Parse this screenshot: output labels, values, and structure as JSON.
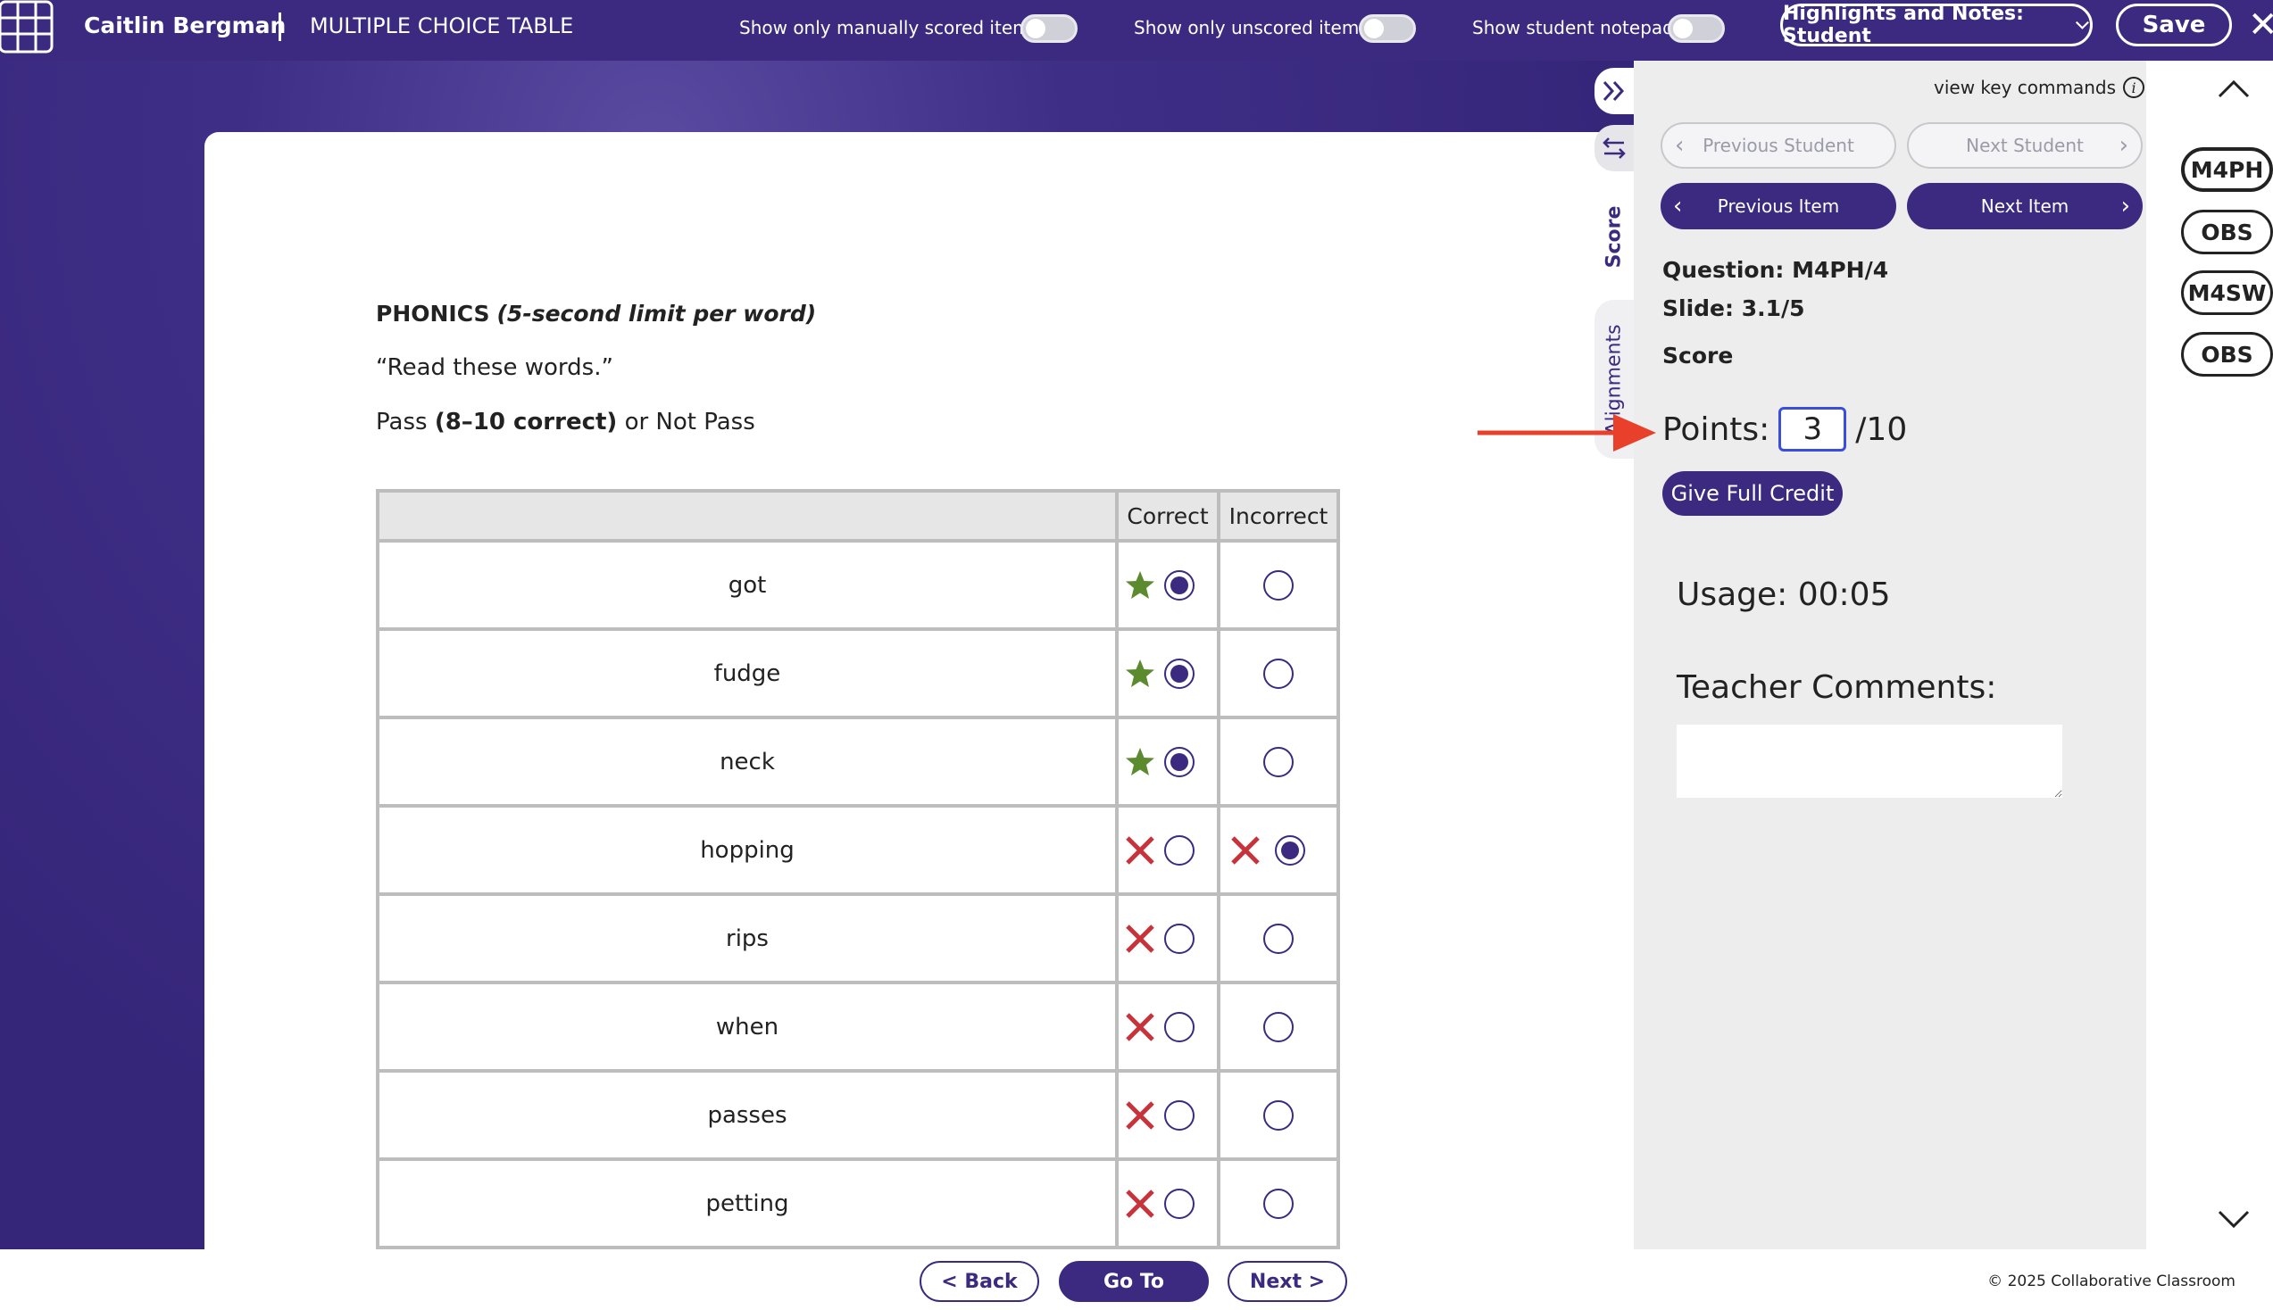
{
  "header": {
    "student_name": "Caitlin Bergman",
    "page_type": "MULTIPLE CHOICE TABLE",
    "toggles": [
      {
        "label": "Show only manually scored items:",
        "on": false
      },
      {
        "label": "Show only unscored items:",
        "on": false
      },
      {
        "label": "Show student notepad:",
        "on": false
      }
    ],
    "highlights_dropdown": "Highlights and Notes: Student",
    "save_label": "Save"
  },
  "content": {
    "heading_bold": "PHONICS",
    "heading_italic": "(5-second limit per word)",
    "prompt": "“Read these words.”",
    "pass_prefix": "Pass",
    "pass_bold": "(8–10 correct)",
    "pass_suffix": "or Not Pass",
    "table": {
      "headers": [
        "",
        "Correct",
        "Incorrect"
      ],
      "rows": [
        {
          "word": "got",
          "selected": "correct",
          "key": "correct"
        },
        {
          "word": "fudge",
          "selected": "correct",
          "key": "correct"
        },
        {
          "word": "neck",
          "selected": "correct",
          "key": "correct"
        },
        {
          "word": "hopping",
          "selected": "incorrect",
          "key": "incorrect"
        },
        {
          "word": "rips",
          "selected": "none",
          "key": "incorrect"
        },
        {
          "word": "when",
          "selected": "none",
          "key": "incorrect"
        },
        {
          "word": "passes",
          "selected": "none",
          "key": "incorrect"
        },
        {
          "word": "petting",
          "selected": "none",
          "key": "incorrect"
        }
      ]
    }
  },
  "footer": {
    "back_label": "< Back",
    "goto_label": "Go To",
    "next_label": "Next >",
    "copyright": "© 2025 Collaborative Classroom"
  },
  "side_tabs": {
    "score": "Score",
    "alignments": "Alignments"
  },
  "panel": {
    "view_key_commands": "view key commands",
    "prev_student": "Previous Student",
    "next_student": "Next Student",
    "prev_item": "Previous Item",
    "next_item": "Next Item",
    "question": "Question: M4PH/4",
    "slide": "Slide: 3.1/5",
    "score_heading": "Score",
    "points_label": "Points:",
    "points_value": "3",
    "points_total": "/10",
    "full_credit": "Give Full Credit",
    "usage": "Usage: 00:05",
    "teacher_comments": "Teacher Comments:",
    "comments_value": ""
  },
  "question_chips": [
    "M4PH",
    "OBS",
    "M4SW",
    "OBS"
  ],
  "colors": {
    "brand_purple": "#3b2a7f",
    "correct_star": "#5c8a2e",
    "incorrect_x": "#c8323a",
    "annotation_arrow": "#e8402a"
  }
}
